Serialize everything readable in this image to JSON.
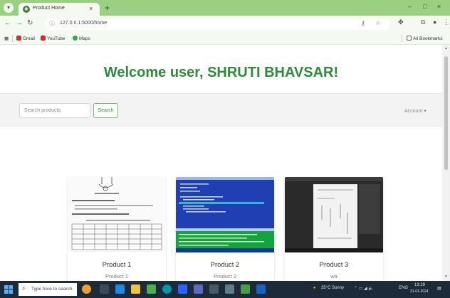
{
  "browser": {
    "tab_title": "Product Home",
    "tab_close": "×",
    "new_tab": "+",
    "window_controls": [
      "–",
      "□",
      "×"
    ],
    "url": "127.0.0.1:5000/home",
    "bookmarks": [
      {
        "label": "Gmail",
        "icon": "gmail-icon",
        "color": "#d93025"
      },
      {
        "label": "YouTube",
        "icon": "youtube-icon",
        "color": "#e62117"
      },
      {
        "label": "Maps",
        "icon": "maps-icon",
        "color": "#34a853"
      }
    ],
    "all_bookmarks": "All Bookmarks"
  },
  "page": {
    "welcome": "Welcome user, SHRUTI BHAVSAR!",
    "search": {
      "placeholder": "Search products",
      "button": "Search"
    },
    "account": "Account ▾",
    "accent_color": "#2e8b3a",
    "products": [
      {
        "title": "Product 1",
        "subtitle": "Product 1",
        "image": "handwritten-circuit-notes"
      },
      {
        "title": "Product 2",
        "subtitle": "Product 2",
        "image": "blue-code-editor-screenshot"
      },
      {
        "title": "Product 3",
        "subtitle": "wa",
        "image": "dark-screenshot-with-document"
      }
    ]
  },
  "taskbar": {
    "search_placeholder": "Type here to search",
    "weather": "35°C Sunny",
    "language": "ENG",
    "time": "13:29",
    "date": "31-01-2024"
  }
}
